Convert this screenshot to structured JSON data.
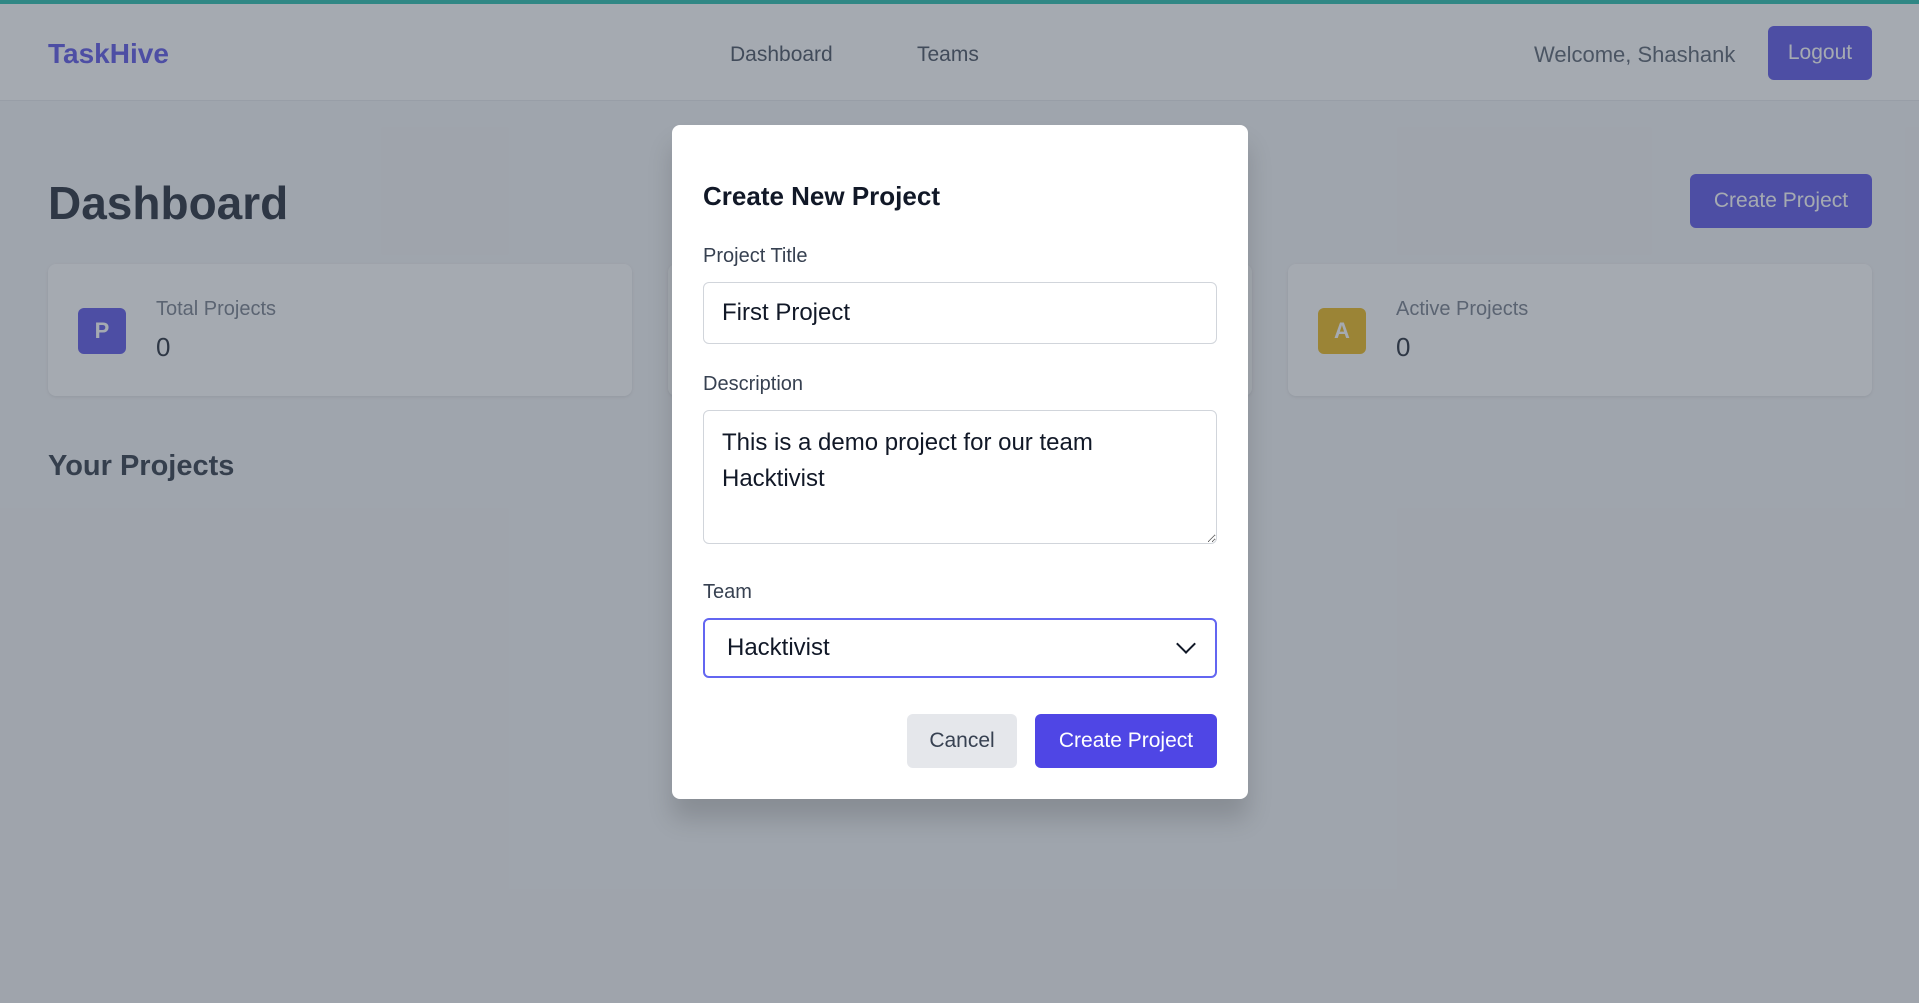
{
  "header": {
    "brand": "TaskHive",
    "nav": [
      "Dashboard",
      "Teams"
    ],
    "welcome": "Welcome, Shashank",
    "logout_label": "Logout"
  },
  "main": {
    "title": "Dashboard",
    "create_button": "Create Project",
    "stats": [
      {
        "icon_letter": "P",
        "label": "Total Projects",
        "value": "0",
        "color": "#4f46e5"
      },
      {
        "icon_letter": "A",
        "label": "Active Projects",
        "value": "0",
        "color": "#eab308"
      }
    ],
    "section_title": "Your Projects"
  },
  "modal": {
    "title": "Create New Project",
    "project_title_label": "Project Title",
    "project_title_value": "First Project",
    "description_label": "Description",
    "description_value": "This is a demo project for our team Hacktivist",
    "team_label": "Team",
    "team_selected": "Hacktivist",
    "cancel_label": "Cancel",
    "submit_label": "Create Project"
  },
  "colors": {
    "accent": "#4f46e5",
    "top_line": "#14b8a6",
    "overlay": "rgba(75,85,99,0.5)"
  }
}
